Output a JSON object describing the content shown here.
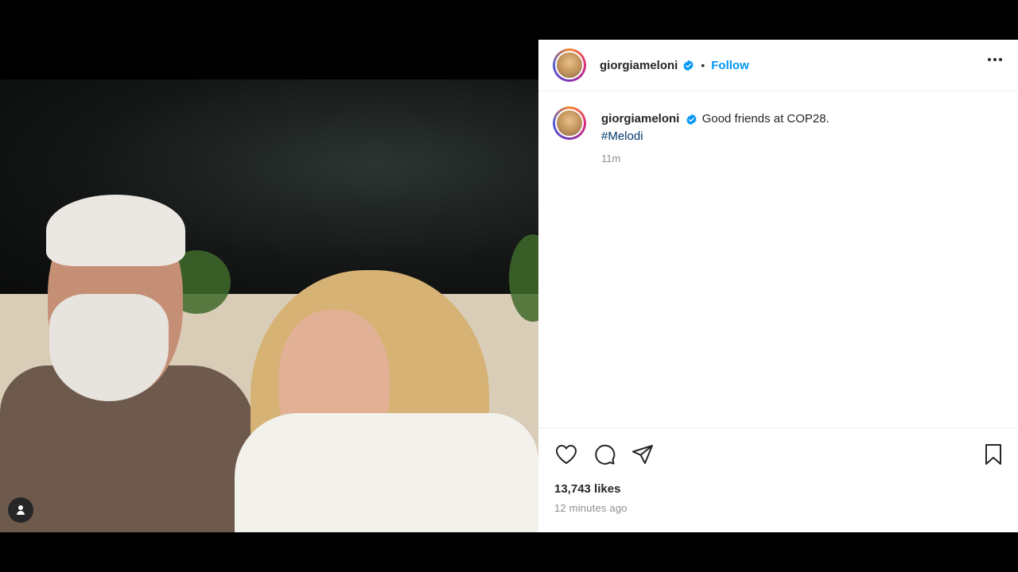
{
  "post": {
    "username": "giorgiameloni",
    "separator": "•",
    "follow_label": "Follow",
    "caption": {
      "username": "giorgiameloni",
      "text": "Good friends at COP28.",
      "hashtag": "#Melodi",
      "time": "11m"
    },
    "likes": "13,743 likes",
    "posted_ago": "12 minutes ago"
  },
  "icons": {
    "header_more": "more-options-icon",
    "verified": "verified-badge-icon",
    "like": "heart-icon",
    "comment": "comment-icon",
    "share": "send-icon",
    "save": "bookmark-icon",
    "photo_user_tag": "user-tag-icon"
  },
  "colors": {
    "accent_blue": "#0095f6",
    "verified_blue": "#0095f6",
    "hashtag": "#00376b"
  }
}
